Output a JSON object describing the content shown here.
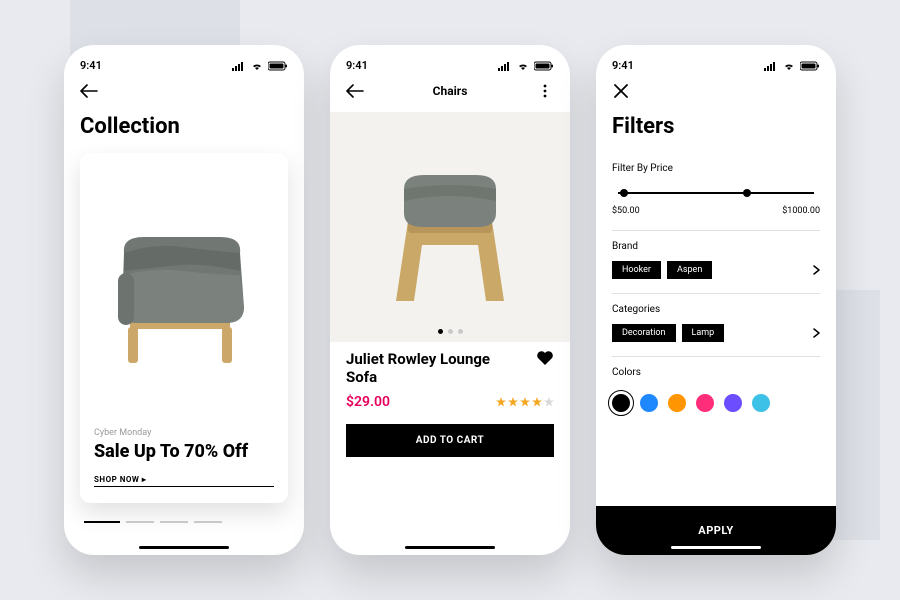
{
  "status": {
    "time": "9:41"
  },
  "screen1": {
    "heading": "Collection",
    "promo": {
      "eyebrow": "Cyber Monday",
      "title": "Sale Up To 70% Off",
      "cta": "SHOP NOW ▸"
    }
  },
  "screen2": {
    "nav_title": "Chairs",
    "product": {
      "name": "Juliet Rowley Lounge Sofa",
      "price": "$29.00",
      "rating": 4
    },
    "add_to_cart": "ADD TO CART"
  },
  "screen3": {
    "heading": "Filters",
    "price": {
      "label": "Filter By Price",
      "min": "$50.00",
      "max": "$1000.00"
    },
    "brand": {
      "label": "Brand",
      "chips": [
        "Hooker",
        "Aspen"
      ]
    },
    "categories": {
      "label": "Categories",
      "chips": [
        "Decoration",
        "Lamp"
      ]
    },
    "colors": {
      "label": "Colors",
      "values": [
        "#000000",
        "#1f88ff",
        "#ff9500",
        "#ff2d7a",
        "#6c4dff",
        "#3dc1e6"
      ],
      "selected": 0
    },
    "apply": "APPLY"
  }
}
